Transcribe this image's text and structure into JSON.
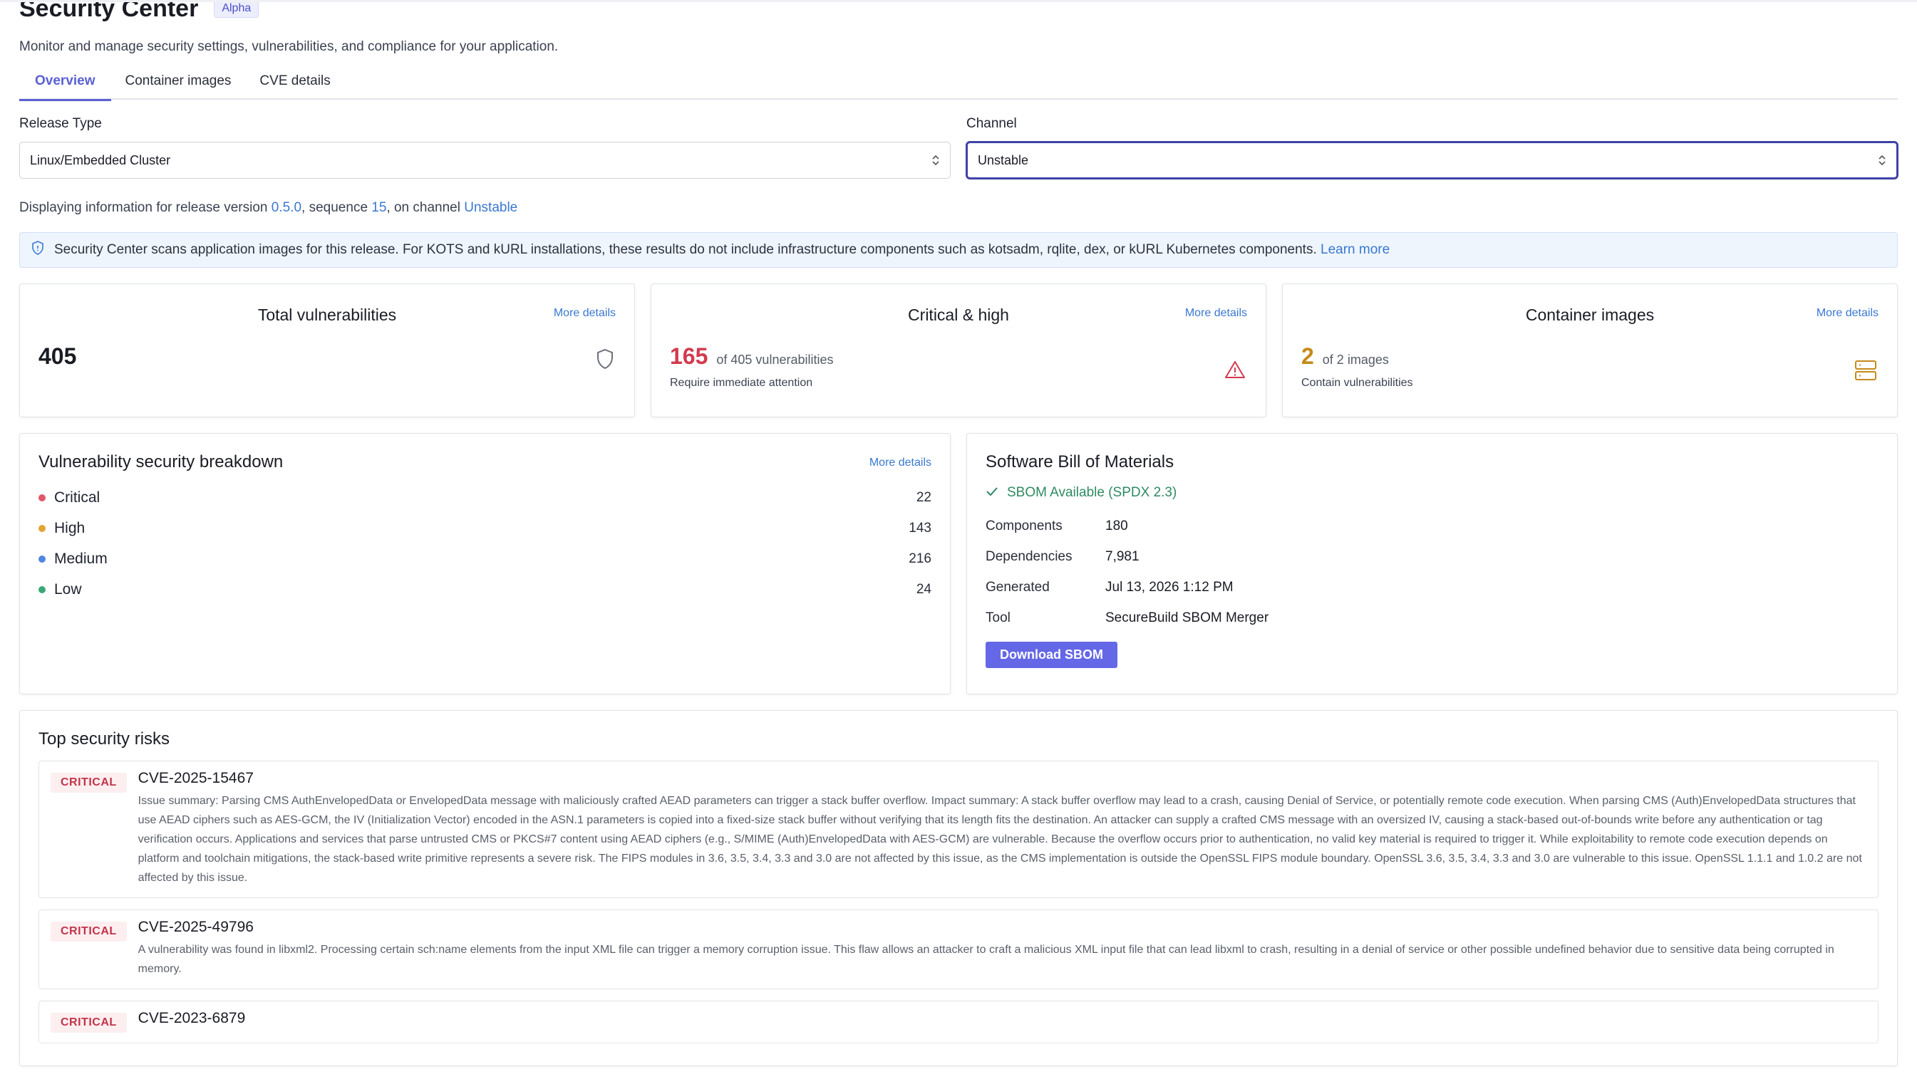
{
  "page": {
    "title": "Security Center",
    "badge": "Alpha",
    "subtitle": "Monitor and manage security settings, vulnerabilities, and compliance for your application."
  },
  "tabs": [
    "Overview",
    "Container images",
    "CVE details"
  ],
  "filters": {
    "release_type": {
      "label": "Release Type",
      "value": "Linux/Embedded Cluster"
    },
    "channel": {
      "label": "Channel",
      "value": "Unstable"
    }
  },
  "release_info": {
    "prefix": "Displaying information for release version ",
    "version": "0.5.0",
    "mid1": ", sequence ",
    "sequence": "15",
    "mid2": ", on channel ",
    "channel": "Unstable"
  },
  "banner": {
    "text": "Security Center scans application images for this release. For KOTS and kURL installations, these results do not include infrastructure components such as kotsadm, rqlite, dex, or kURL Kubernetes components.",
    "link": "Learn more"
  },
  "stats": {
    "total": {
      "title": "Total vulnerabilities",
      "value": "405",
      "more": "More details"
    },
    "critical_high": {
      "title": "Critical & high",
      "value": "165",
      "of": "of 405 vulnerabilities",
      "note": "Require immediate attention",
      "more": "More details"
    },
    "images": {
      "title": "Container images",
      "value": "2",
      "of": "of 2 images",
      "note": "Contain vulnerabilities",
      "more": "More details"
    }
  },
  "breakdown": {
    "title": "Vulnerability security breakdown",
    "more": "More details",
    "items": [
      {
        "label": "Critical",
        "count": "22",
        "color": "#e0566b"
      },
      {
        "label": "High",
        "count": "143",
        "color": "#e3a431"
      },
      {
        "label": "Medium",
        "count": "216",
        "color": "#4f86e0"
      },
      {
        "label": "Low",
        "count": "24",
        "color": "#3aa876"
      }
    ]
  },
  "sbom": {
    "title": "Software Bill of Materials",
    "status": "SBOM Available (SPDX 2.3)",
    "rows": [
      {
        "key": "Components",
        "value": "180"
      },
      {
        "key": "Dependencies",
        "value": "7,981"
      },
      {
        "key": "Generated",
        "value": "Jul 13, 2026 1:12 PM"
      },
      {
        "key": "Tool",
        "value": "SecureBuild SBOM Merger"
      }
    ],
    "button": "Download SBOM"
  },
  "risks": {
    "title": "Top security risks",
    "items": [
      {
        "severity": "CRITICAL",
        "id": "CVE-2025-15467",
        "desc": "Issue summary: Parsing CMS AuthEnvelopedData or EnvelopedData message with maliciously crafted AEAD parameters can trigger a stack buffer overflow. Impact summary: A stack buffer overflow may lead to a crash, causing Denial of Service, or potentially remote code execution. When parsing CMS (Auth)EnvelopedData structures that use AEAD ciphers such as AES-GCM, the IV (Initialization Vector) encoded in the ASN.1 parameters is copied into a fixed-size stack buffer without verifying that its length fits the destination. An attacker can supply a crafted CMS message with an oversized IV, causing a stack-based out-of-bounds write before any authentication or tag verification occurs. Applications and services that parse untrusted CMS or PKCS#7 content using AEAD ciphers (e.g., S/MIME (Auth)EnvelopedData with AES-GCM) are vulnerable. Because the overflow occurs prior to authentication, no valid key material is required to trigger it. While exploitability to remote code execution depends on platform and toolchain mitigations, the stack-based write primitive represents a severe risk. The FIPS modules in 3.6, 3.5, 3.4, 3.3 and 3.0 are not affected by this issue, as the CMS implementation is outside the OpenSSL FIPS module boundary. OpenSSL 3.6, 3.5, 3.4, 3.3 and 3.0 are vulnerable to this issue. OpenSSL 1.1.1 and 1.0.2 are not affected by this issue."
      },
      {
        "severity": "CRITICAL",
        "id": "CVE-2025-49796",
        "desc": "A vulnerability was found in libxml2. Processing certain sch:name elements from the input XML file can trigger a memory corruption issue. This flaw allows an attacker to craft a malicious XML input file that can lead libxml to crash, resulting in a denial of service or other possible undefined behavior due to sensitive data being corrupted in memory."
      },
      {
        "severity": "CRITICAL",
        "id": "CVE-2023-6879",
        "desc": ""
      }
    ]
  },
  "colors": {
    "accent": "#5a5fd4",
    "link": "#3a78d0",
    "critical": "#d33a4f",
    "amber": "#c48a1a",
    "success": "#2f8a63"
  }
}
